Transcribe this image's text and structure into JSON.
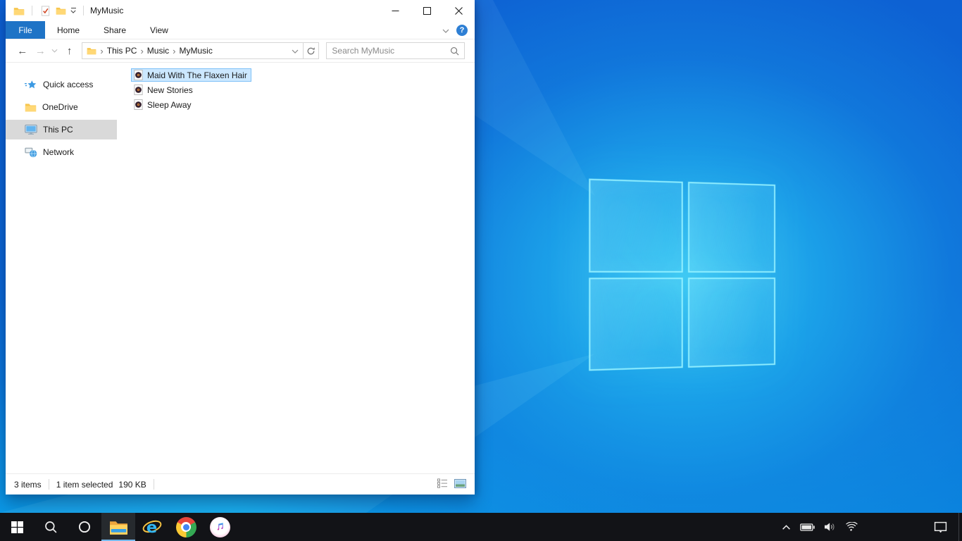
{
  "glyphs": {
    "crumb_separator": "›",
    "help": "?",
    "back_arrow": "←",
    "forward_arrow": "→",
    "up_arrow": "↑",
    "ie_e": "e"
  },
  "window": {
    "titlebar": {
      "title": "MyMusic",
      "quick_access_tools": [
        "properties",
        "new-folder",
        "customize-toolbar"
      ],
      "controls": [
        "minimize",
        "maximize",
        "close"
      ]
    },
    "ribbon": {
      "tabs": [
        {
          "label": "File",
          "active": true
        },
        {
          "label": "Home",
          "active": false
        },
        {
          "label": "Share",
          "active": false
        },
        {
          "label": "View",
          "active": false
        }
      ]
    },
    "navbar": {
      "breadcrumb": {
        "items": [
          {
            "label": "This PC"
          },
          {
            "label": "Music"
          },
          {
            "label": "MyMusic"
          }
        ]
      },
      "search": {
        "placeholder": "Search MyMusic"
      }
    },
    "sidebar": {
      "items": [
        {
          "label": "Quick access",
          "icon": "quick-access-star-icon",
          "selected": false
        },
        {
          "label": "OneDrive",
          "icon": "folder-icon",
          "selected": false
        },
        {
          "label": "This PC",
          "icon": "this-pc-monitor-icon",
          "selected": true
        },
        {
          "label": "Network",
          "icon": "network-icon",
          "selected": false
        }
      ]
    },
    "files": [
      {
        "name": "Maid With The Flaxen Hair",
        "icon": "music-file-icon",
        "selected": true
      },
      {
        "name": "New Stories",
        "icon": "music-file-icon",
        "selected": false
      },
      {
        "name": "Sleep Away",
        "icon": "music-file-icon",
        "selected": false
      }
    ],
    "statusbar": {
      "items_count": "3 items",
      "selection_count": "1 item selected",
      "selection_size": "190 KB",
      "view_buttons": [
        "details-view-icon",
        "thumbnail-view-icon"
      ]
    }
  },
  "taskbar": {
    "buttons": [
      {
        "name": "start",
        "active": false
      },
      {
        "name": "search",
        "active": false
      },
      {
        "name": "cortana",
        "active": false
      },
      {
        "name": "file-explorer",
        "active": true
      },
      {
        "name": "internet-explorer",
        "active": false
      },
      {
        "name": "chrome",
        "active": false
      },
      {
        "name": "itunes",
        "active": false
      }
    ],
    "tray": [
      {
        "name": "hidden-icons-chevron"
      },
      {
        "name": "battery"
      },
      {
        "name": "volume"
      },
      {
        "name": "wifi"
      },
      {
        "name": "action-center"
      }
    ]
  },
  "desktop": {
    "wallpaper": "windows-10-light-blue",
    "logo": "windows-logo"
  },
  "colors": {
    "accent_tab": "#1e73c6",
    "selection_fill": "#cce8ff",
    "selection_border": "#7fc1f7",
    "sidebar_selected": "#d9d9d9",
    "taskbar_bg": "#121317",
    "taskbar_active_underline": "#76b9ed",
    "wallpaper_deep": "#0d5fd2",
    "wallpaper_glow": "#40cdf4"
  }
}
